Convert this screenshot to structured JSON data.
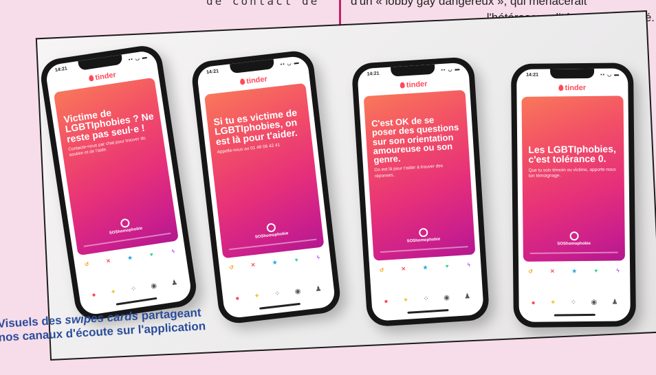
{
  "page": {
    "top_left": "de contact de",
    "top_right_line1": "d'un « lobby gay dangereux », qui menacerait",
    "top_right_line2": "l'hétérosexualité et la cisidentité."
  },
  "phones": [
    {
      "time": "14:21",
      "brand": "tinder",
      "headline": "Victime de LGBTIphobies ? Ne reste pas seul·e !",
      "subtext": "Contacte-nous par chat pour trouver du soutien et de l'aide.",
      "org": "SOShomophobie"
    },
    {
      "time": "14:21",
      "brand": "tinder",
      "headline": "Si tu es victime de LGBTIphobies, on est là pour t'aider.",
      "subtext": "Appelle-nous au 01 48 06 42 41",
      "org": "SOShomophobie"
    },
    {
      "time": "14:21",
      "brand": "tinder",
      "headline": "C'est OK de se poser des questions sur son orientation amoureuse ou son genre.",
      "subtext": "On est là pour t'aider à trouver des réponses.",
      "org": "SOShomophobie"
    },
    {
      "time": "14:21",
      "brand": "tinder",
      "headline": "Les LGBTIphobies, c'est tolérance 0.",
      "subtext": "Que tu sois témoin ou victime, apporte-nous ton témoignage.",
      "org": "SOShomophobie"
    }
  ],
  "caption": {
    "line1_prefix": "Visuels des",
    "line1_italic": "swipes cards",
    "line1_suffix": "partageant",
    "line2": "nos canaux d'écoute sur l'application"
  },
  "colors": {
    "background": "#f7dde9",
    "accent_rule": "#c4206c",
    "caption": "#2a4d9a",
    "tinder": "#fd4a5a"
  }
}
